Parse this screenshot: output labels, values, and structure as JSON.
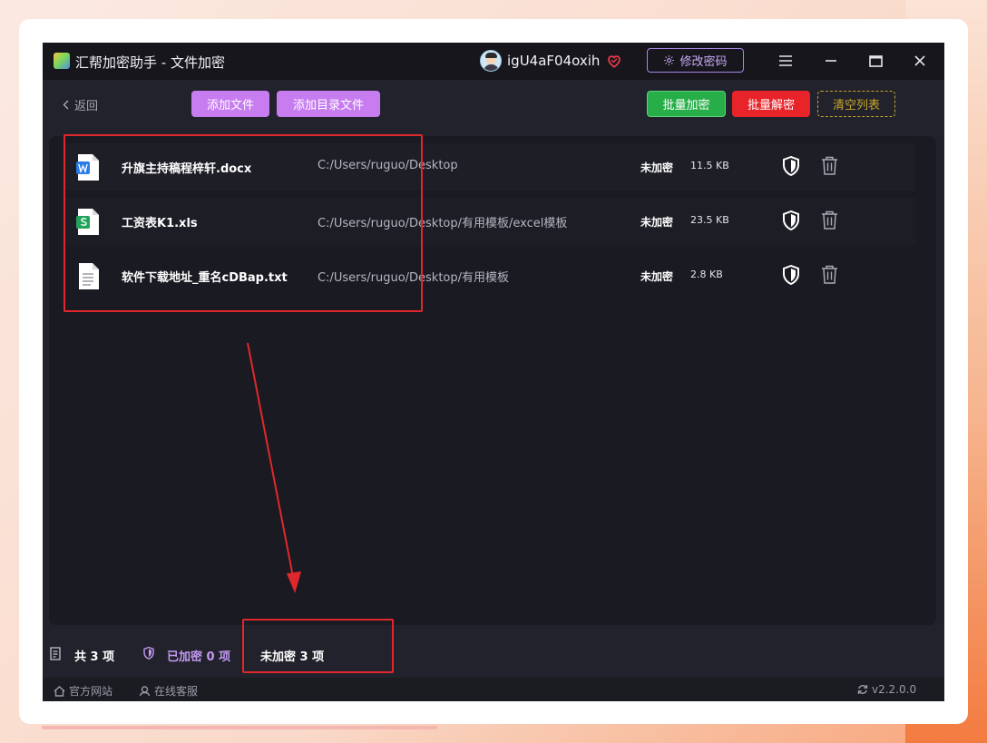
{
  "window": {
    "title": "汇帮加密助手 - 文件加密",
    "username": "igU4aF04oxih",
    "change_password_label": "修改密码"
  },
  "toolbar": {
    "back_label": "返回",
    "add_file_label": "添加文件",
    "add_dir_label": "添加目录文件",
    "batch_encrypt_label": "批量加密",
    "batch_decrypt_label": "批量解密",
    "clear_list_label": "清空列表"
  },
  "files": [
    {
      "name": "升旗主持稿程梓轩.docx",
      "path": "C:/Users/ruguo/Desktop",
      "status": "未加密",
      "size": "11.5 KB",
      "icon": "word-doc-icon"
    },
    {
      "name": "工资表K1.xls",
      "path": "C:/Users/ruguo/Desktop/有用模板/excel模板",
      "status": "未加密",
      "size": "23.5 KB",
      "icon": "spreadsheet-icon"
    },
    {
      "name": "软件下载地址_重名cDBap.txt",
      "path": "C:/Users/ruguo/Desktop/有用模板",
      "status": "未加密",
      "size": "2.8 KB",
      "icon": "text-file-icon"
    }
  ],
  "status_bar": {
    "total": "共 3 项",
    "encrypted": "已加密 0 项",
    "unencrypted": "未加密 3 项"
  },
  "footer": {
    "website_label": "官方网站",
    "service_label": "在线客服",
    "version": "v2.2.0.0"
  },
  "colors": {
    "accent_purple": "#c77df0",
    "encrypt_green": "#27ae49",
    "decrypt_red": "#e8242a",
    "clear_gold": "#c9a52a",
    "annotation_red": "#e0282c"
  }
}
